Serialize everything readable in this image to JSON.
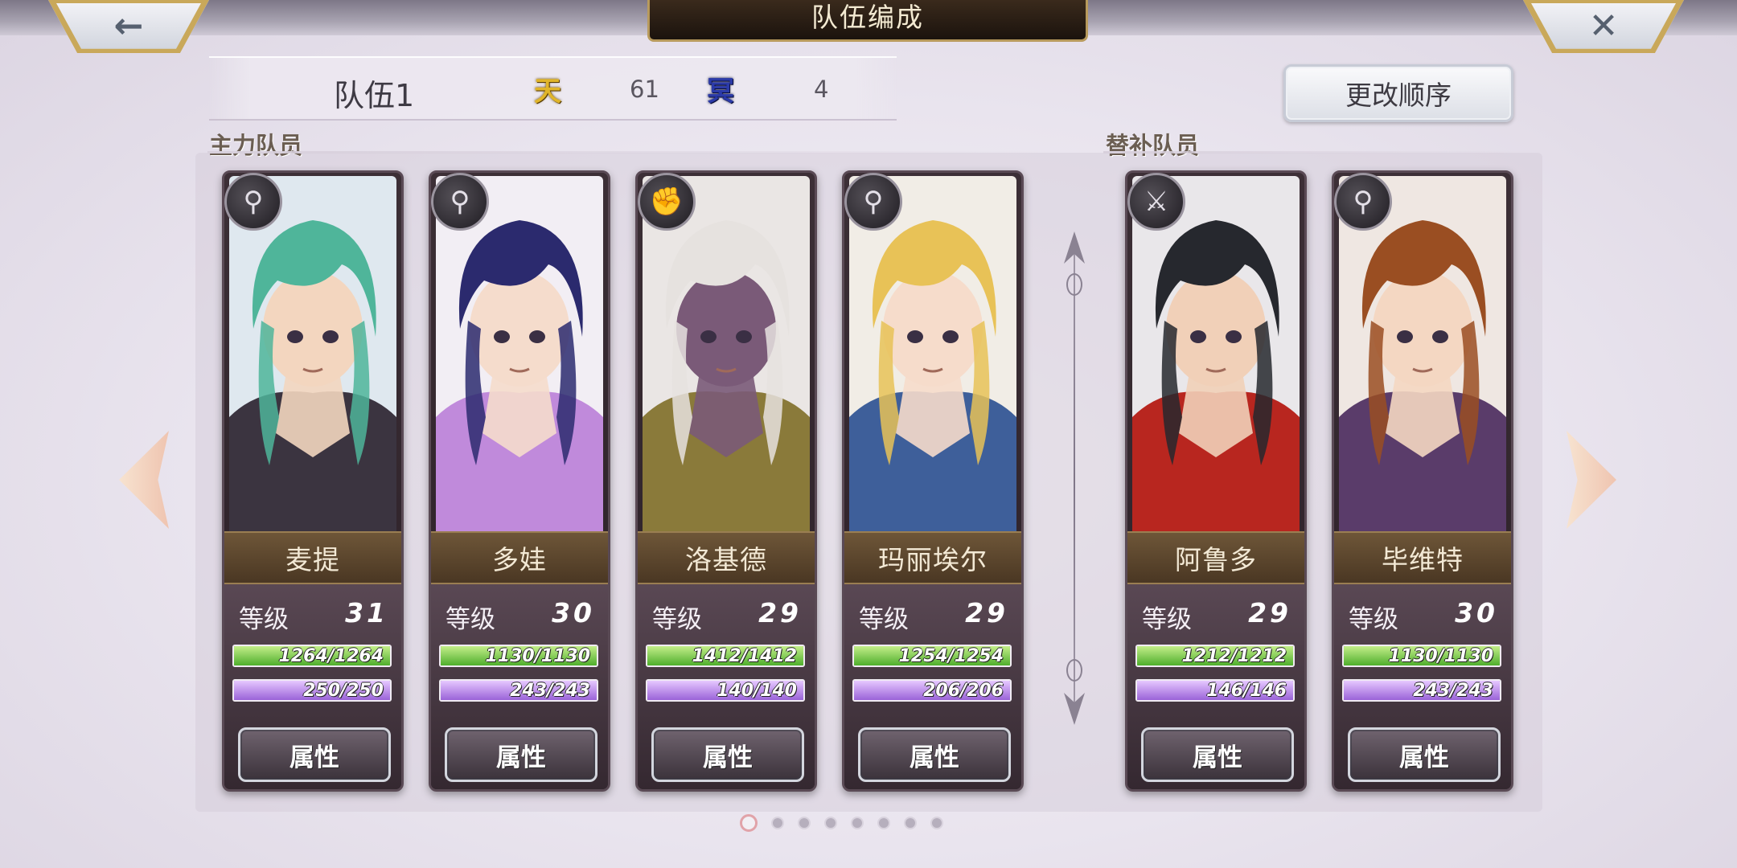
{
  "header": {
    "title": "队伍编成",
    "back_icon": "arrow-left-icon",
    "close_icon": "close-icon"
  },
  "team": {
    "name": "队伍1",
    "sky_label": "天",
    "sky_value": "61",
    "dark_label": "冥",
    "dark_value": "4",
    "reorder_label": "更改顺序"
  },
  "sections": {
    "main_label": "主力队员",
    "sub_label": "替补队员"
  },
  "colors": {
    "hp_bar": "#4fae2c",
    "mp_bar": "#9a63d8",
    "name_band": "#6e5638",
    "sky_icon": "#e0b52a",
    "dark_icon": "#2b3aa8"
  },
  "characters": [
    {
      "name": "麦提",
      "class_icon": "staff-icon",
      "level_label": "等级",
      "level": "31",
      "hp": "1264/1264",
      "hp_ratio": 1.0,
      "mp": "250/250",
      "mp_ratio": 1.0,
      "attr_label": "属性",
      "hair": "#4fb59a",
      "outfit": "#3b3440",
      "skin": "#f3d6bf",
      "bg": "#dfe8ef"
    },
    {
      "name": "多娃",
      "class_icon": "staff-icon",
      "level_label": "等级",
      "level": "30",
      "hp": "1130/1130",
      "hp_ratio": 1.0,
      "mp": "243/243",
      "mp_ratio": 1.0,
      "attr_label": "属性",
      "hair": "#2b2a6e",
      "outfit": "#c08adb",
      "skin": "#f5dccc",
      "bg": "#f2eef4"
    },
    {
      "name": "洛基德",
      "class_icon": "fist-icon",
      "level_label": "等级",
      "level": "29",
      "hp": "1412/1412",
      "hp_ratio": 1.0,
      "mp": "140/140",
      "mp_ratio": 1.0,
      "attr_label": "属性",
      "hair": "#e6e2df",
      "outfit": "#8a7a3a",
      "skin": "#7a5a78",
      "bg": "#eae6e4"
    },
    {
      "name": "玛丽埃尔",
      "class_icon": "staff-icon",
      "level_label": "等级",
      "level": "29",
      "hp": "1254/1254",
      "hp_ratio": 1.0,
      "mp": "206/206",
      "mp_ratio": 1.0,
      "attr_label": "属性",
      "hair": "#e8c257",
      "outfit": "#3e5f9a",
      "skin": "#f6dccb",
      "bg": "#f1ede6"
    },
    {
      "name": "阿鲁多",
      "class_icon": "sword-icon",
      "level_label": "等级",
      "level": "29",
      "hp": "1212/1212",
      "hp_ratio": 1.0,
      "mp": "146/146",
      "mp_ratio": 1.0,
      "attr_label": "属性",
      "hair": "#26282e",
      "outfit": "#b8261f",
      "skin": "#f1d0b8",
      "bg": "#e9e7ea"
    },
    {
      "name": "毕维特",
      "class_icon": "staff-icon",
      "level_label": "等级",
      "level": "30",
      "hp": "1130/1130",
      "hp_ratio": 1.0,
      "mp": "243/243",
      "mp_ratio": 1.0,
      "attr_label": "属性",
      "hair": "#9a4e22",
      "outfit": "#5a3c6a",
      "skin": "#f4d7c2",
      "bg": "#efe7e2"
    }
  ],
  "pager": {
    "total": 8,
    "current": 1
  }
}
